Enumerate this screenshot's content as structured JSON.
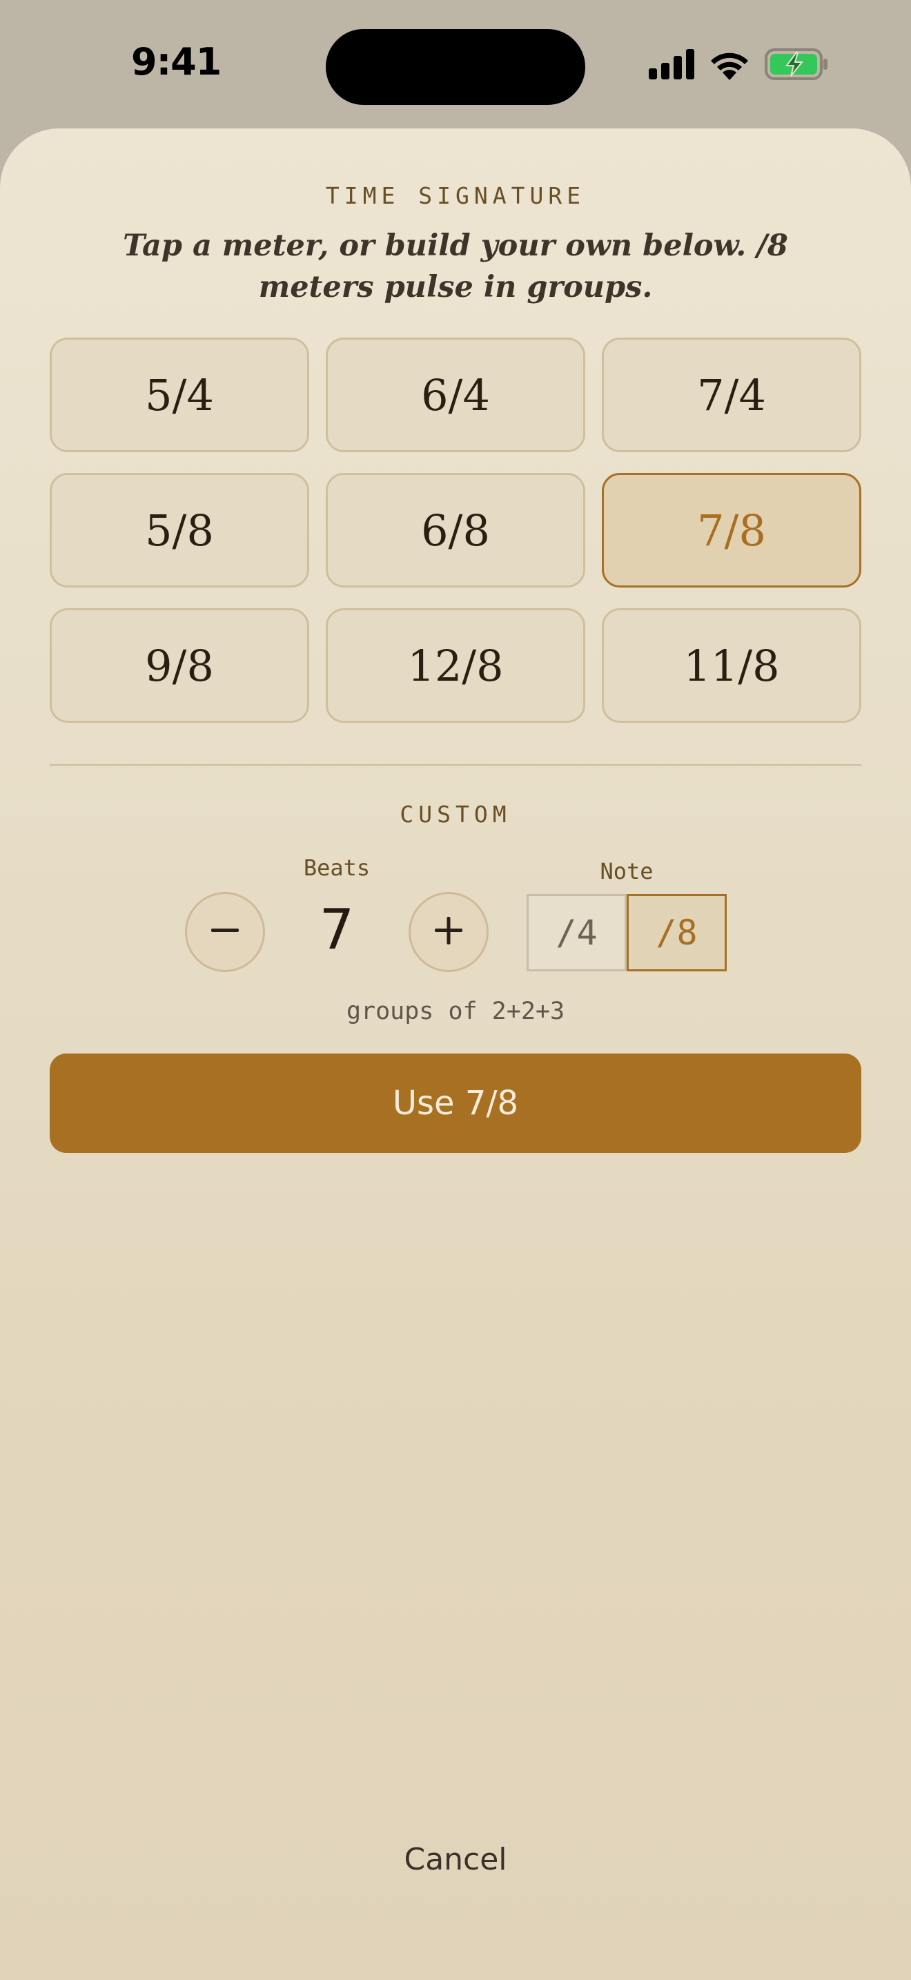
{
  "status_bar": {
    "time": "9:41",
    "icons": [
      "cellular-signal-icon",
      "wifi-icon",
      "battery-charging-icon"
    ],
    "battery_color": "#34c759"
  },
  "sheet": {
    "eyebrow": "TIME SIGNATURE",
    "subtitle": "Tap a meter, or build your own below. /8 meters pulse in groups.",
    "meters": [
      {
        "label": "5/4",
        "selected": false
      },
      {
        "label": "6/4",
        "selected": false
      },
      {
        "label": "7/4",
        "selected": false
      },
      {
        "label": "5/8",
        "selected": false
      },
      {
        "label": "6/8",
        "selected": false
      },
      {
        "label": "7/8",
        "selected": true
      },
      {
        "label": "9/8",
        "selected": false
      },
      {
        "label": "12/8",
        "selected": false
      },
      {
        "label": "11/8",
        "selected": false
      }
    ],
    "custom": {
      "heading": "CUSTOM",
      "beats_label": "Beats",
      "beats_value": "7",
      "decrement_icon": "minus-icon",
      "increment_icon": "plus-icon",
      "note_label": "Note",
      "note_options": [
        {
          "label": "/4",
          "selected": false
        },
        {
          "label": "/8",
          "selected": true
        }
      ],
      "groups_text": "groups of 2+2+3"
    },
    "use_button": "Use 7/8",
    "cancel_button": "Cancel"
  },
  "colors": {
    "accent": "#a77022",
    "selected_text": "#a86e22",
    "sheet_background": "#ede5d2"
  }
}
